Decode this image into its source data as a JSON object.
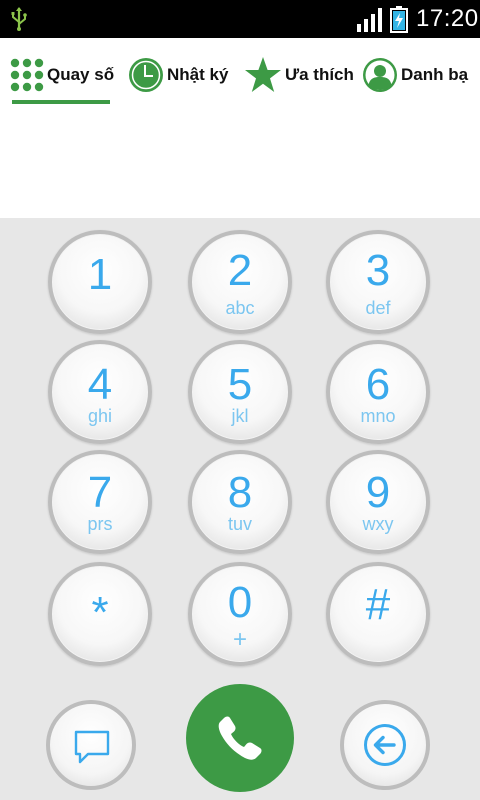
{
  "status_bar": {
    "time": "17:20",
    "icons": [
      "usb-icon",
      "signal-icon",
      "battery-charging-icon"
    ]
  },
  "tabs": [
    {
      "label": "Quay số",
      "icon": "dialpad-icon",
      "selected": true
    },
    {
      "label": "Nhật ký",
      "icon": "clock-icon",
      "selected": false
    },
    {
      "label": "Ưa thích",
      "icon": "star-icon",
      "selected": false
    },
    {
      "label": "Danh bạ",
      "icon": "contact-icon",
      "selected": false
    }
  ],
  "number_display": {
    "value": ""
  },
  "keypad": {
    "keys": [
      {
        "digit": "1",
        "letters": ""
      },
      {
        "digit": "2",
        "letters": "abc"
      },
      {
        "digit": "3",
        "letters": "def"
      },
      {
        "digit": "4",
        "letters": "ghi"
      },
      {
        "digit": "5",
        "letters": "jkl"
      },
      {
        "digit": "6",
        "letters": "mno"
      },
      {
        "digit": "7",
        "letters": "prs"
      },
      {
        "digit": "8",
        "letters": "tuv"
      },
      {
        "digit": "9",
        "letters": "wxy"
      },
      {
        "digit": "*",
        "letters": ""
      },
      {
        "digit": "0",
        "letters": "+"
      },
      {
        "digit": "#",
        "letters": ""
      }
    ]
  },
  "actions": {
    "sms_icon": "message-icon",
    "call_icon": "phone-icon",
    "delete_icon": "backspace-icon"
  },
  "colors": {
    "accent_green": "#3d9a45",
    "digit_blue": "#3aa9ec",
    "keypad_bg": "#e7e7e7"
  }
}
